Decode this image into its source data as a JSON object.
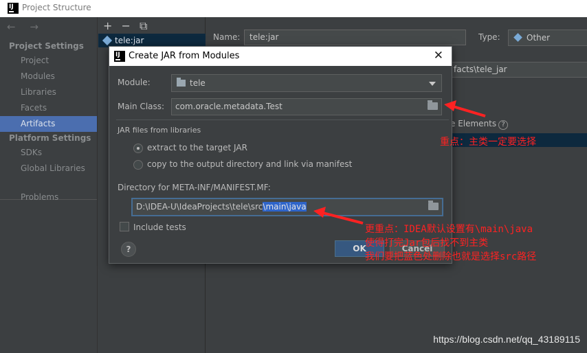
{
  "window": {
    "title": "Project Structure",
    "logo_text": "IJ"
  },
  "sidebar": {
    "nav_arrows": "←  →",
    "project_settings_label": "Project Settings",
    "platform_settings_label": "Platform Settings",
    "items": [
      {
        "label": "Project"
      },
      {
        "label": "Modules"
      },
      {
        "label": "Libraries"
      },
      {
        "label": "Facets"
      },
      {
        "label": "Artifacts"
      },
      {
        "label": "SDKs"
      },
      {
        "label": "Global Libraries"
      },
      {
        "label": "Problems"
      }
    ],
    "selected": "Artifacts"
  },
  "artifact_list": {
    "toolbar": [
      "+",
      "−",
      "⧉"
    ],
    "items": [
      "tele:jar"
    ]
  },
  "artifact_editor": {
    "name_label": "Name:",
    "name_value": "tele:jar",
    "type_label": "Type:",
    "type_value": "Other",
    "output_dir_partial": "facts\\tele_jar",
    "elements_label": "e Elements",
    "help_glyph": "?"
  },
  "dialog": {
    "title": "Create JAR from Modules",
    "close_glyph": "✕",
    "module_label": "Module:",
    "module_value": "tele",
    "main_class_label": "Main Class:",
    "main_class_value": "com.oracle.metadata.Test",
    "jar_files_label": "JAR files from libraries",
    "radio_extract": "extract to the target JAR",
    "radio_copy": "copy to the output directory and link via manifest",
    "radio_selected": "extract to the target JAR",
    "manifest_dir_label": "Directory for META-INF/MANIFEST.MF:",
    "manifest_dir_prefix": "D:\\IDEA-U\\IdeaProjects\\tele\\src",
    "manifest_dir_selected": "\\main\\java",
    "include_tests_label": "Include tests",
    "include_tests_checked": false,
    "help_glyph": "?",
    "ok_label": "OK",
    "cancel_label": "Cancel"
  },
  "annotations": {
    "note1": "重点：主类一定要选择",
    "note2_line1": "更重点：IDEA默认设置有\\main\\java",
    "note2_line2": "使得打完Jar包后找不到主类",
    "note2_line3": "我们要把蓝色处删除也就是选择src路径",
    "color": "#ff2222"
  },
  "watermark": "https://blog.csdn.net/qq_43189115"
}
